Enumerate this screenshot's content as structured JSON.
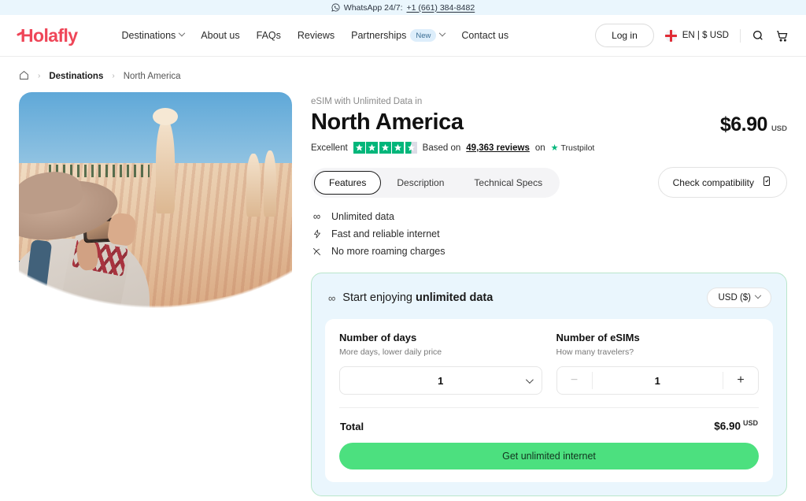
{
  "topbar": {
    "icon": "whatsapp-icon",
    "text": "WhatsApp 24/7:",
    "phone": "+1 (661) 384-8482"
  },
  "header": {
    "logo": "Holafly",
    "nav": [
      {
        "label": "Destinations",
        "caret": true
      },
      {
        "label": "About us",
        "caret": false
      },
      {
        "label": "FAQs",
        "caret": false
      },
      {
        "label": "Reviews",
        "caret": false
      },
      {
        "label": "Partnerships",
        "caret": true,
        "badge": "New"
      },
      {
        "label": "Contact us",
        "caret": false
      }
    ],
    "login_label": "Log in",
    "locale": "EN | $ USD",
    "flag": "uk-flag-icon",
    "search_icon": "search-icon",
    "cart_icon": "cart-icon"
  },
  "breadcrumb": {
    "home_icon": "home-icon",
    "separator": "›",
    "items": [
      {
        "label": "Destinations",
        "current": false
      },
      {
        "label": "North America",
        "current": true
      }
    ]
  },
  "hero": {
    "alt": "Traveler in hat photographing Bryce Canyon hoodoos with a smartphone"
  },
  "product": {
    "eyebrow": "eSIM with Unlimited Data in",
    "title": "North America",
    "price": "$6.90",
    "price_currency": "USD",
    "rating": {
      "word": "Excellent",
      "stars": 4.5,
      "based_on_prefix": "Based on",
      "reviews": "49,363 reviews",
      "on": "on",
      "platform": "Trustpilot"
    },
    "tabs": [
      {
        "label": "Features",
        "active": true
      },
      {
        "label": "Description",
        "active": false
      },
      {
        "label": "Technical Specs",
        "active": false
      }
    ],
    "compatibility_label": "Check compatibility",
    "compatibility_icon": "phone-check-icon",
    "features": [
      {
        "icon": "infinity-icon",
        "glyph": "∞",
        "label": "Unlimited data"
      },
      {
        "icon": "lightning-bolt-icon",
        "glyph": "⚡",
        "label": "Fast and reliable internet"
      },
      {
        "icon": "no-roaming-icon",
        "glyph": "⌁",
        "label": "No more roaming charges"
      }
    ]
  },
  "buy": {
    "header_icon": "infinity-icon",
    "header_glyph": "∞",
    "header_prefix": "Start enjoying ",
    "header_strong": "unlimited data",
    "currency_selected": "USD ($)",
    "days": {
      "label": "Number of days",
      "sub": "More days, lower daily price",
      "value": "1"
    },
    "esims": {
      "label": "Number of eSIMs",
      "sub": "How many travelers?",
      "value": "1",
      "minus": "−",
      "plus": "+"
    },
    "total_label": "Total",
    "total_value": "$6.90",
    "total_currency": "USD",
    "cta_label": "Get unlimited internet"
  },
  "colors": {
    "brand": "#ef4658",
    "cta_green": "#4ce07f",
    "panel_blue": "#eaf6fd",
    "trustpilot_green": "#00b67a",
    "card_border_green": "#b9e6cb"
  }
}
